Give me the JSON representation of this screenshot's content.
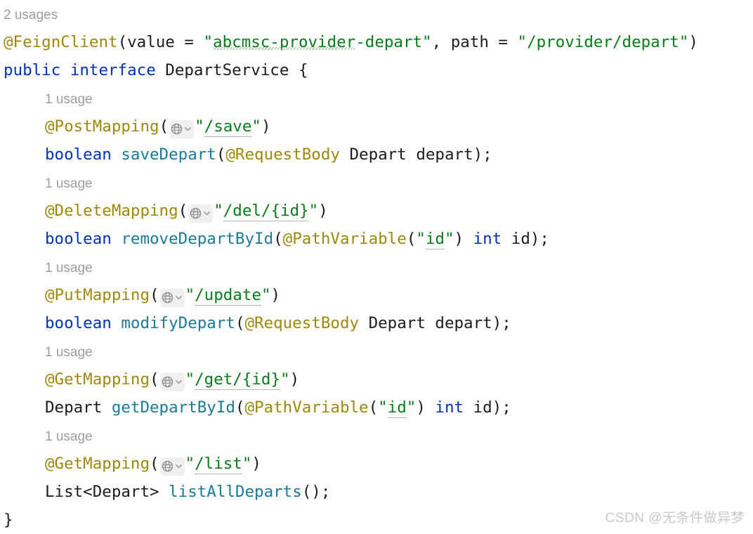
{
  "editor": {
    "language": "java",
    "interface_name": "DepartService",
    "colors": {
      "background": "#ffffff",
      "keyword": "#0033b3",
      "string": "#067d17",
      "annotation": "#9e880d",
      "method": "#1a7a99",
      "plain_text": "#1c1c1c",
      "hint_gray": "#9a9da1",
      "inlay_background": "#f0f0f0",
      "watermark": "#c9c9c9"
    },
    "hints": {
      "class_usages": "2 usages",
      "method_usages": "1 usage"
    },
    "inlay_icon": {
      "globe": "globe-icon",
      "chevron": "chevron-down-icon"
    },
    "class_declaration": {
      "annotation_name": "@FeignClient",
      "open_paren": "(",
      "value_key": "value",
      "equals": " = ",
      "value_literal": "\"abcmsc-provider-depart\"",
      "value_literal_underlined": "abcmsc-provider",
      "comma": ", ",
      "path_key": "path",
      "path_literal": "\"/provider/depart\"",
      "close_paren": ")",
      "modifier": "public",
      "keyword": "interface",
      "name": "DepartService",
      "open_brace": "{",
      "close_brace": "}"
    },
    "methods": [
      {
        "usages": "1 usage",
        "annotation": "@PostMapping",
        "path": "\"/save\"",
        "path_text": "/save",
        "return_type": "boolean",
        "return_type_kind": "keyword",
        "name": "saveDepart",
        "params_prefix": "@RequestBody",
        "param_type": "Depart",
        "param_name": "depart",
        "signature_tail": ");"
      },
      {
        "usages": "1 usage",
        "annotation": "@DeleteMapping",
        "path": "\"/del/{id}\"",
        "path_text": "/del/{id}",
        "return_type": "boolean",
        "return_type_kind": "keyword",
        "name": "removeDepartById",
        "params_prefix": "@PathVariable",
        "param_literal": "\"id\"",
        "param_literal_text": "id",
        "param_type": "int",
        "param_type_kind": "keyword",
        "param_name": "id",
        "signature_tail": ");"
      },
      {
        "usages": "1 usage",
        "annotation": "@PutMapping",
        "path": "\"/update\"",
        "path_text": "/update",
        "return_type": "boolean",
        "return_type_kind": "keyword",
        "name": "modifyDepart",
        "params_prefix": "@RequestBody",
        "param_type": "Depart",
        "param_name": "depart",
        "signature_tail": ");"
      },
      {
        "usages": "1 usage",
        "annotation": "@GetMapping",
        "path": "\"/get/{id}\"",
        "path_text": "/get/{id}",
        "return_type": "Depart",
        "return_type_kind": "plain",
        "name": "getDepartById",
        "params_prefix": "@PathVariable",
        "param_literal": "\"id\"",
        "param_literal_text": "id",
        "param_type": "int",
        "param_type_kind": "keyword",
        "param_name": "id",
        "signature_tail": ");"
      },
      {
        "usages": "1 usage",
        "annotation": "@GetMapping",
        "path": "\"/list\"",
        "path_text": "/list",
        "return_type": "List<Depart>",
        "return_type_kind": "plain",
        "name": "listAllDeparts",
        "signature_tail": "();"
      }
    ]
  },
  "watermark": {
    "text": "CSDN @无条件做异梦"
  }
}
